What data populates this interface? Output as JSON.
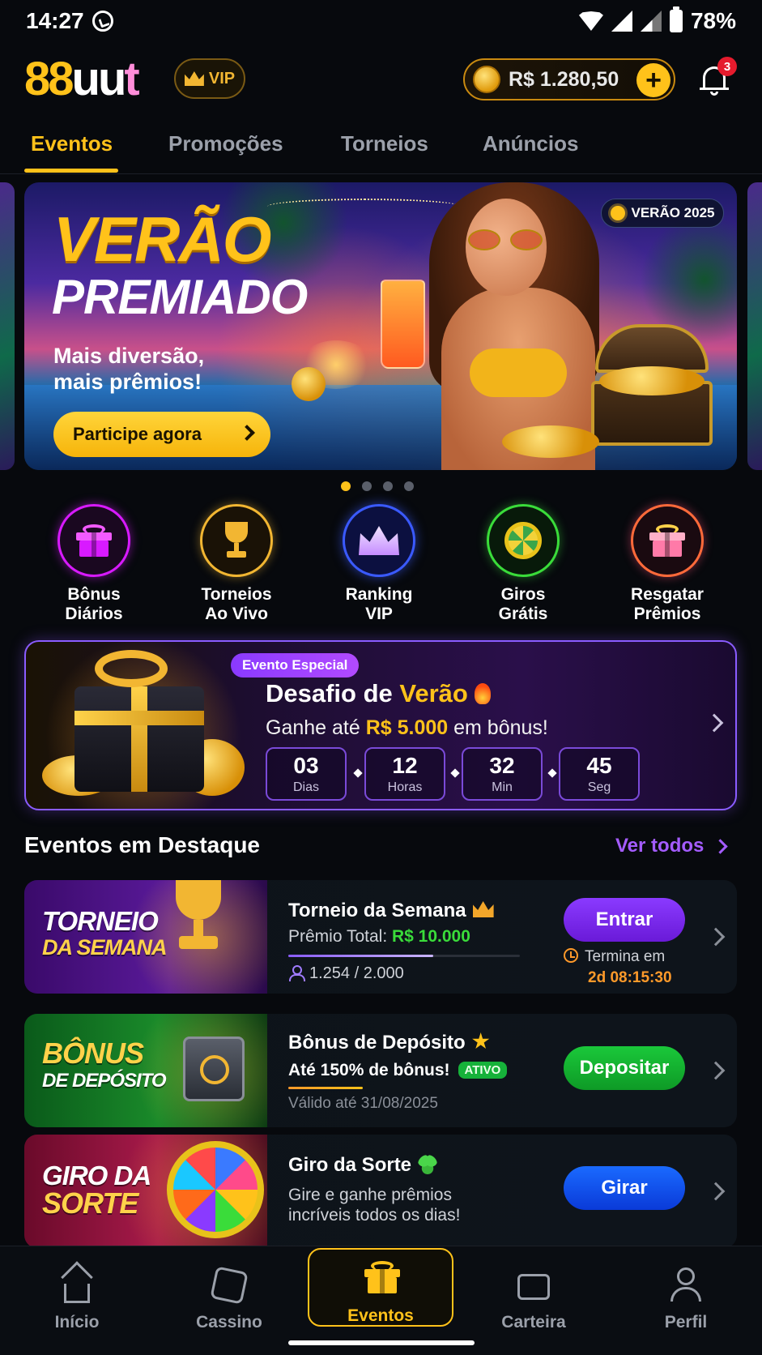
{
  "status_bar": {
    "time": "14:27",
    "battery": "78%",
    "icons": [
      "whatsapp-icon",
      "wifi-icon",
      "signal-icon",
      "signal-icon",
      "battery-icon"
    ]
  },
  "header": {
    "logo_part1": "88",
    "logo_part2": "uu",
    "logo_part3": "t",
    "vip_label": "VIP",
    "balance": "R$ 1.280,50",
    "add_label": "+",
    "notification_count": "3"
  },
  "tabs": [
    {
      "label": "Eventos",
      "active": true
    },
    {
      "label": "Promoções",
      "active": false
    },
    {
      "label": "Torneios",
      "active": false
    },
    {
      "label": "Anúncios",
      "active": false
    }
  ],
  "hero": {
    "tag": "VERÃO 2025",
    "title_line1": "VERÃO",
    "title_line2": "PREMIADO",
    "subtitle_line1": "Mais diversão,",
    "subtitle_line2": "mais prêmios!",
    "cta": "Participe agora",
    "slides_total": 4,
    "active_slide": 1
  },
  "quick_actions": [
    {
      "line1": "Bônus",
      "line2": "Diários",
      "icon": "gift-icon",
      "color": "#d81aff"
    },
    {
      "line1": "Torneios",
      "line2": "Ao Vivo",
      "icon": "trophy-icon",
      "color": "#f2b632"
    },
    {
      "line1": "Ranking",
      "line2": "VIP",
      "icon": "crown-icon",
      "color": "#3a5aff"
    },
    {
      "line1": "Giros",
      "line2": "Grátis",
      "icon": "wheel-icon",
      "color": "#3adc3a"
    },
    {
      "line1": "Resgatar",
      "line2": "Prêmios",
      "icon": "gift-icon",
      "color": "#ff6a3a"
    }
  ],
  "special_event": {
    "tag": "Evento Especial",
    "title_prefix": "Desafio de ",
    "title_highlight": "Verão",
    "sub_prefix": "Ganhe até ",
    "sub_highlight": "R$ 5.000",
    "sub_suffix": " em bônus!",
    "countdown": [
      {
        "value": "03",
        "unit": "Dias"
      },
      {
        "value": "12",
        "unit": "Horas"
      },
      {
        "value": "32",
        "unit": "Min"
      },
      {
        "value": "45",
        "unit": "Seg"
      }
    ]
  },
  "featured": {
    "title": "Eventos em Destaque",
    "see_all": "Ver todos",
    "items": [
      {
        "thumb_line1": "TORNEIO",
        "thumb_line2": "DA SEMANA",
        "name": "Torneio da Semana",
        "prize_label": "Prêmio Total: ",
        "prize_value": "R$ 10.000",
        "participants": "1.254 / 2.000",
        "progress": 0.627,
        "button": "Entrar",
        "ends_label": "Termina em",
        "ends_value": "2d 08:15:30"
      },
      {
        "thumb_line1": "BÔNUS",
        "thumb_line2": "DE DEPÓSITO",
        "name": "Bônus de Depósito",
        "offer": "Até 150% de bônus!",
        "status": "ATIVO",
        "valid_label": "Válido até ",
        "valid_value": "31/08/2025",
        "progress": 0.32,
        "button": "Depositar"
      },
      {
        "thumb_line1": "GIRO DA",
        "thumb_line2": "SORTE",
        "name": "Giro da Sorte",
        "desc_line1": "Gire e ganhe prêmios",
        "desc_line2": "incríveis todos os dias!",
        "button": "Girar"
      }
    ]
  },
  "bottom_nav": [
    {
      "label": "Início",
      "active": false
    },
    {
      "label": "Cassino",
      "active": false
    },
    {
      "label": "Eventos",
      "active": true
    },
    {
      "label": "Carteira",
      "active": false
    },
    {
      "label": "Perfil",
      "active": false
    }
  ],
  "colors": {
    "accent": "#ffc21a",
    "purple": "#8a5cff",
    "green": "#16b23a",
    "blue": "#1a5aff",
    "background": "#07090d"
  }
}
